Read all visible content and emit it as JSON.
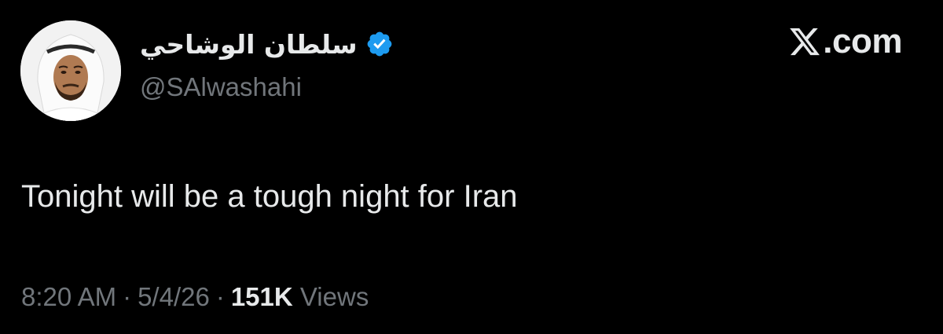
{
  "author": {
    "display_name": "سلطان الوشاحي",
    "handle": "@SAlwashahi",
    "verified": true,
    "verified_color": "#1d9bf0",
    "avatar_icon": "profile-photo"
  },
  "brand": {
    "logo_text": ".com",
    "logo_icon": "x-logo-icon"
  },
  "tweet": {
    "text": "Tonight will be a tough night for Iran"
  },
  "meta": {
    "time": "8:20 AM",
    "separator": "·",
    "date": "5/4/26",
    "views_count": "151K",
    "views_label": "Views"
  },
  "colors": {
    "background": "#000000",
    "primary_text": "#e7e9ea",
    "secondary_text": "#71767b",
    "accent": "#1d9bf0"
  }
}
